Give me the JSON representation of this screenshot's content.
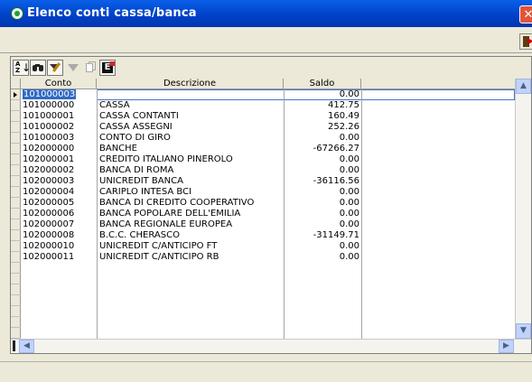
{
  "window": {
    "title": "Elenco conti cassa/banca",
    "close_glyph": "✕"
  },
  "icons": [
    "app-icon",
    "close-icon",
    "exit-door-icon",
    "sort-az-icon",
    "binoculars-search-icon",
    "edit-filter-icon",
    "filter-funnel-icon",
    "copy-icon",
    "excel-export-icon"
  ],
  "grid": {
    "columns": [
      "Conto",
      "Descrizione",
      "Saldo"
    ],
    "rows": [
      {
        "conto": "101000003",
        "descrizione": "",
        "saldo": "0.00"
      },
      {
        "conto": "101000000",
        "descrizione": "CASSA",
        "saldo": "412.75"
      },
      {
        "conto": "101000001",
        "descrizione": "CASSA CONTANTI",
        "saldo": "160.49"
      },
      {
        "conto": "101000002",
        "descrizione": "CASSA ASSEGNI",
        "saldo": "252.26"
      },
      {
        "conto": "101000003",
        "descrizione": "CONTO DI GIRO",
        "saldo": "0.00"
      },
      {
        "conto": "102000000",
        "descrizione": "BANCHE",
        "saldo": "-67266.27"
      },
      {
        "conto": "102000001",
        "descrizione": "CREDITO ITALIANO PINEROLO",
        "saldo": "0.00"
      },
      {
        "conto": "102000002",
        "descrizione": "BANCA DI ROMA",
        "saldo": "0.00"
      },
      {
        "conto": "102000003",
        "descrizione": "UNICREDIT BANCA",
        "saldo": "-36116.56"
      },
      {
        "conto": "102000004",
        "descrizione": "CARIPLO INTESA BCI",
        "saldo": "0.00"
      },
      {
        "conto": "102000005",
        "descrizione": "BANCA DI CREDITO COOPERATIVO",
        "saldo": "0.00"
      },
      {
        "conto": "102000006",
        "descrizione": "BANCA POPOLARE DELL'EMILIA",
        "saldo": "0.00"
      },
      {
        "conto": "102000007",
        "descrizione": "BANCA REGIONALE EUROPEA",
        "saldo": "0.00"
      },
      {
        "conto": "102000008",
        "descrizione": "B.C.C. CHERASCO",
        "saldo": "-31149.71"
      },
      {
        "conto": "102000010",
        "descrizione": "UNICREDIT C/ANTICIPO FT",
        "saldo": "0.00"
      },
      {
        "conto": "102000011",
        "descrizione": "UNICREDIT C/ANTICIPO RB",
        "saldo": "0.00"
      }
    ]
  },
  "scroll": {
    "up": "▲",
    "down": "▼",
    "left": "◀",
    "right": "▶"
  },
  "colors": {
    "title_bar": "#0042c8",
    "selection": "#316ac5",
    "close_button": "#e2543a"
  }
}
